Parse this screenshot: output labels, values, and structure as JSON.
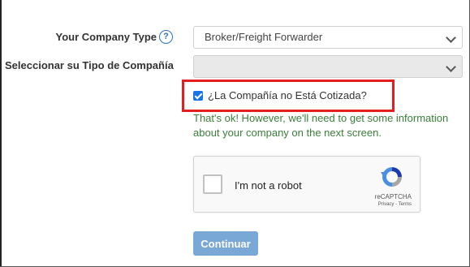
{
  "form": {
    "company_type_label": "Your Company Type",
    "company_type_value": "Broker/Freight Forwarder",
    "select_type_label": "Seleccionar su Tipo de Compañía",
    "select_type_value": "",
    "not_listed_checkbox_label": "¿La Compañía no Está Cotizada?",
    "not_listed_checked": true,
    "info_text": "That's ok! However, we'll need to get some information about your company on the next screen.",
    "submit_label": "Continuar"
  },
  "recaptcha": {
    "label": "I'm not a robot",
    "brand": "reCAPTCHA",
    "links": "Privacy - Terms"
  },
  "icons": {
    "help": "question-circle-icon",
    "chevron": "chevron-down-icon",
    "check": "check-icon",
    "recaptcha_logo": "recaptcha-logo-icon"
  },
  "colors": {
    "highlight": "#e41e1e",
    "accent": "#1a73e8",
    "info_text": "#3a7f3a",
    "submit_bg": "#79a7d6"
  }
}
